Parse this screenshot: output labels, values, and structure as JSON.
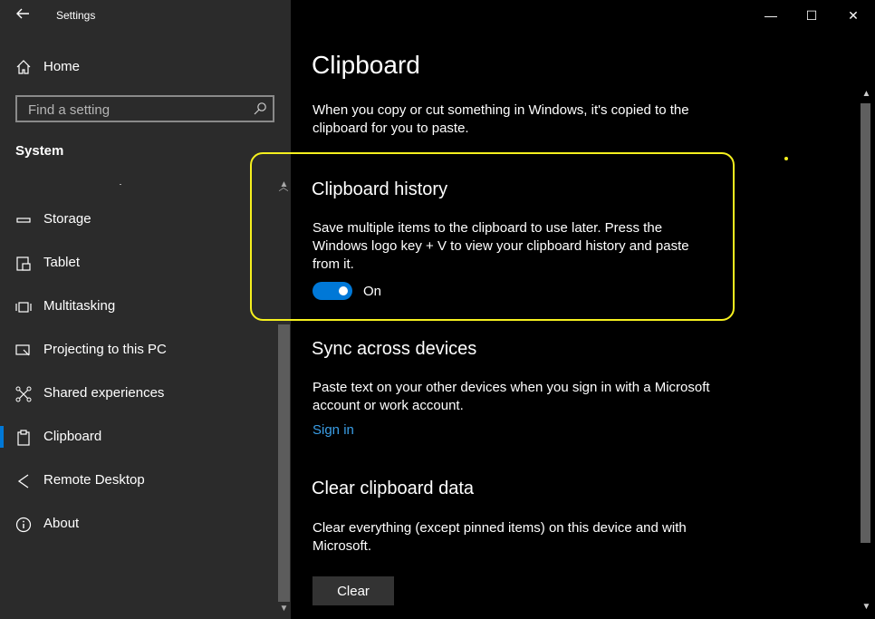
{
  "window": {
    "title": "Settings",
    "controls": {
      "minimize": "—",
      "maximize": "☐",
      "close": "✕"
    }
  },
  "sidebar": {
    "home_label": "Home",
    "search_placeholder": "Find a setting",
    "section_label": "System",
    "items": [
      {
        "label": "Storage",
        "icon": "storage-icon"
      },
      {
        "label": "Tablet",
        "icon": "tablet-icon"
      },
      {
        "label": "Multitasking",
        "icon": "multitasking-icon"
      },
      {
        "label": "Projecting to this PC",
        "icon": "projecting-icon"
      },
      {
        "label": "Shared experiences",
        "icon": "shared-experiences-icon"
      },
      {
        "label": "Clipboard",
        "icon": "clipboard-icon",
        "selected": true
      },
      {
        "label": "Remote Desktop",
        "icon": "remote-desktop-icon"
      },
      {
        "label": "About",
        "icon": "info-icon"
      }
    ]
  },
  "main": {
    "title": "Clipboard",
    "intro": "When you copy or cut something in Windows, it's copied to the clipboard for you to paste.",
    "history": {
      "heading": "Clipboard history",
      "description": "Save multiple items to the clipboard to use later. Press the Windows logo key + V to view your clipboard history and paste from it.",
      "toggle_state": "On"
    },
    "sync": {
      "heading": "Sync across devices",
      "description": "Paste text on your other devices when you sign in with a Microsoft account or work account.",
      "link": "Sign in"
    },
    "clear": {
      "heading": "Clear clipboard data",
      "description": "Clear everything (except pinned items) on this device and with Microsoft.",
      "button": "Clear"
    }
  },
  "colors": {
    "accent": "#0078d7",
    "highlight": "#f5f01e",
    "sidebar_bg": "#2b2b2b",
    "link": "#3a9ee6"
  }
}
